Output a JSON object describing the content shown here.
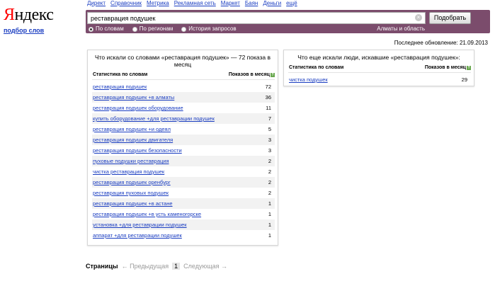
{
  "brand": {
    "logo_first": "Я",
    "logo_rest": "ндекс",
    "service": "подбор слов"
  },
  "topnav": [
    "Директ",
    "Справочник",
    "Метрика",
    "Рекламная сеть",
    "Маркет",
    "Баян",
    "Деньги",
    "ещё"
  ],
  "search": {
    "query": "реставрация подушек",
    "button": "Подобрать",
    "clear_icon": "×"
  },
  "modes": [
    {
      "label": "По словам",
      "selected": true
    },
    {
      "label": "По регионам",
      "selected": false
    },
    {
      "label": "История запросов",
      "selected": false
    }
  ],
  "region": "Алматы и область",
  "updated": "Последнее обновление: 21.09.2013",
  "left": {
    "title": "Что искали со словами «реставрация подушек» — 72 показа в месяц",
    "col_query": "Статистика по словам",
    "col_count": "Показов в месяц",
    "help": "?",
    "rows": [
      {
        "q": "реставрация подушек",
        "n": "72"
      },
      {
        "q": "реставрация подушек +в алматы",
        "n": "36"
      },
      {
        "q": "реставрация подушек оборудование",
        "n": "11"
      },
      {
        "q": "купить оборудование +для реставрации подушек",
        "n": "7"
      },
      {
        "q": "реставрация подушек +и одеял",
        "n": "5"
      },
      {
        "q": "реставрация подушек двигателя",
        "n": "3"
      },
      {
        "q": "реставрация подушек безопасности",
        "n": "3"
      },
      {
        "q": "пуховые подушки реставрация",
        "n": "2"
      },
      {
        "q": "чистка реставрация подушек",
        "n": "2"
      },
      {
        "q": "реставрация подушек оренбург",
        "n": "2"
      },
      {
        "q": "реставрация пуховых подушек",
        "n": "2"
      },
      {
        "q": "реставрация подушек +в астане",
        "n": "1"
      },
      {
        "q": "реставрация подушек +в усть каменогорске",
        "n": "1"
      },
      {
        "q": "установка +для реставрации подушек",
        "n": "1"
      },
      {
        "q": "аппарат +для реставрации подушек",
        "n": "1"
      }
    ]
  },
  "right": {
    "title": "Что еще искали люди, искавшие «реставрация подушек»:",
    "col_query": "Статистика по словам",
    "col_count": "Показов в месяц",
    "help": "?",
    "rows": [
      {
        "q": "чистка подушек",
        "n": "29"
      }
    ]
  },
  "pager": {
    "label": "Страницы",
    "prev": "← Предыдущая",
    "current": "1",
    "next": "Следующая →"
  }
}
